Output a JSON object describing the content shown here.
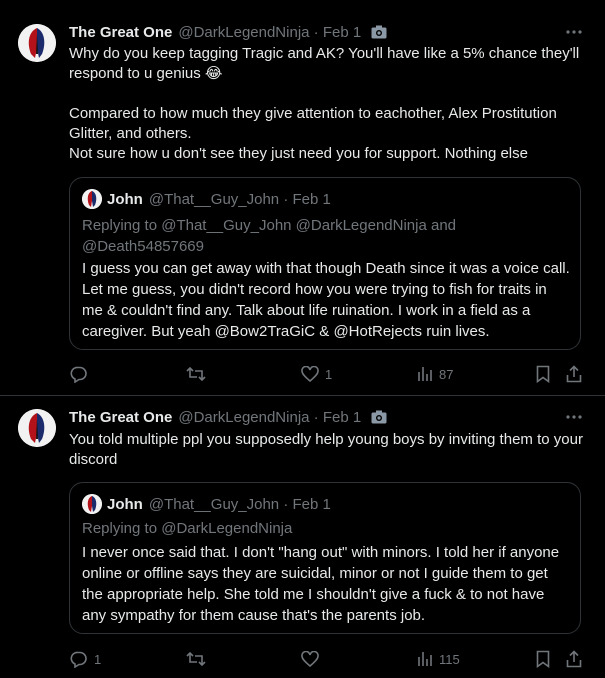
{
  "tweets": [
    {
      "author_name": "The Great One",
      "author_handle": "@DarkLegendNinja · Feb 1",
      "body": "Why do you keep tagging Tragic and AK? You'll have like a 5% chance they'll respond to u genius 😂\n\nCompared to how much they give attention to eachother, Alex Prostitution Glitter, and others.\nNot sure how u don't see they just need you for support. Nothing else",
      "quote": {
        "author_name": "John",
        "author_handle": "@That__Guy_John · Feb 1",
        "replying_to": "Replying to @That__Guy_John @DarkLegendNinja and @Death54857669",
        "text": "I guess you can get away with that though Death since it was a voice call. Let me guess, you didn't record how you were trying to fish for traits in me & couldn't find any. Talk about life ruination. I work in a field as a caregiver. But yeah @Bow2TraGiC & @HotRejects ruin lives."
      },
      "actions": {
        "replies": "",
        "reposts": "",
        "likes": "1",
        "views": "87"
      }
    },
    {
      "author_name": "The Great One",
      "author_handle": "@DarkLegendNinja · Feb 1",
      "body": "You told multiple ppl you supposedly help young boys by inviting them to your discord",
      "quote": {
        "author_name": "John",
        "author_handle": "@That__Guy_John · Feb 1",
        "replying_to": "Replying to @DarkLegendNinja",
        "text": "I never once said that. I don't \"hang out\" with minors. I told her if anyone online or offline says they are suicidal, minor or not I guide them to get the appropriate help. She told me I shouldn't give a fuck & to not have any sympathy for them cause that's the parents job."
      },
      "actions": {
        "replies": "1",
        "reposts": "",
        "likes": "",
        "views": "115"
      }
    }
  ],
  "icons": {
    "camera": "camera-icon",
    "more": "more-icon",
    "reply": "reply-icon",
    "repost": "repost-icon",
    "like": "like-icon",
    "views": "views-icon",
    "bookmark": "bookmark-icon",
    "share": "share-icon"
  },
  "colors": {
    "background": "#000000",
    "text": "#e7e9ea",
    "muted": "#71767b",
    "border": "#2f3336"
  }
}
